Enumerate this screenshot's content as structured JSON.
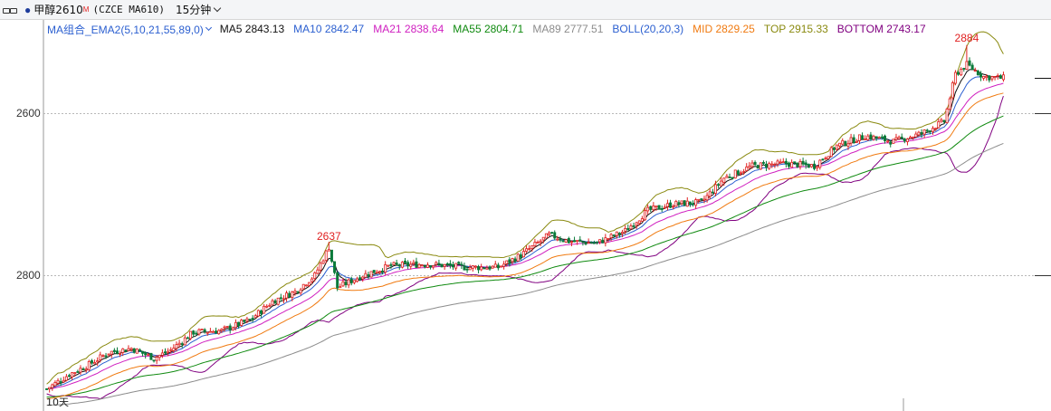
{
  "toolbar": {
    "symbol_name": "甲醇2610",
    "contract_marker": "M",
    "contract_code": "(CZCE MA610)",
    "period": "15分钟"
  },
  "legend": {
    "group_label": "MA组合_EMA2(5,10,21,55,89,0)",
    "items": [
      {
        "text": "MA5 2843.13",
        "color": "#111111"
      },
      {
        "text": "MA10 2842.47",
        "color": "#2b5fd0"
      },
      {
        "text": "MA21 2838.64",
        "color": "#d020c0"
      },
      {
        "text": "MA55 2804.71",
        "color": "#108a10"
      },
      {
        "text": "MA89 2777.51",
        "color": "#8c8c8c"
      },
      {
        "text": "BOLL(20,20,3)",
        "color": "#2b5fd0"
      },
      {
        "text": "MID 2829.25",
        "color": "#f07a10"
      },
      {
        "text": "TOP 2915.33",
        "color": "#8a8a10"
      },
      {
        "text": "BOTTOM 2743.17",
        "color": "#800080"
      }
    ]
  },
  "axis": {
    "y_labels": [
      "2800",
      "2600"
    ],
    "x_label": "10天"
  },
  "annotations": {
    "high_label_1": "2637",
    "high_label_2": "2884"
  },
  "colors": {
    "up": "#e02020",
    "down": "#0a7a3a",
    "ma5": "#111111",
    "ma10": "#2b5fd0",
    "ma21": "#d020c0",
    "ma55": "#108a10",
    "ma89": "#8c8c8c",
    "mid": "#f07a10",
    "top": "#8a8a10",
    "bottom": "#800080",
    "grid": "#b8b8b8"
  },
  "chart_data": {
    "type": "candlestick",
    "y_range": [
      2435,
      2915
    ],
    "y_ticks": [
      2600,
      2800
    ],
    "price_path": [
      [
        0,
        2460
      ],
      [
        8,
        2478
      ],
      [
        14,
        2488
      ],
      [
        22,
        2505
      ],
      [
        30,
        2510
      ],
      [
        38,
        2498
      ],
      [
        44,
        2508
      ],
      [
        52,
        2530
      ],
      [
        62,
        2532
      ],
      [
        72,
        2545
      ],
      [
        80,
        2568
      ],
      [
        88,
        2580
      ],
      [
        95,
        2600
      ],
      [
        100,
        2635
      ],
      [
        103,
        2585
      ],
      [
        112,
        2600
      ],
      [
        122,
        2612
      ],
      [
        135,
        2614
      ],
      [
        148,
        2610
      ],
      [
        160,
        2610
      ],
      [
        168,
        2625
      ],
      [
        178,
        2650
      ],
      [
        185,
        2642
      ],
      [
        195,
        2640
      ],
      [
        205,
        2655
      ],
      [
        213,
        2680
      ],
      [
        222,
        2688
      ],
      [
        232,
        2690
      ],
      [
        240,
        2720
      ],
      [
        250,
        2735
      ],
      [
        262,
        2738
      ],
      [
        272,
        2735
      ],
      [
        280,
        2760
      ],
      [
        290,
        2772
      ],
      [
        300,
        2765
      ],
      [
        310,
        2775
      ],
      [
        318,
        2790
      ],
      [
        322,
        2848
      ],
      [
        326,
        2860
      ],
      [
        332,
        2845
      ],
      [
        340,
        2843
      ]
    ],
    "candle_count": 340,
    "highs_marked": [
      2637,
      2884
    ],
    "latest": {
      "MA5": 2843.13,
      "MA10": 2842.47,
      "MA21": 2838.64,
      "MA55": 2804.71,
      "MA89": 2777.51,
      "MID": 2829.25,
      "TOP": 2915.33,
      "BOTTOM": 2743.17
    }
  }
}
